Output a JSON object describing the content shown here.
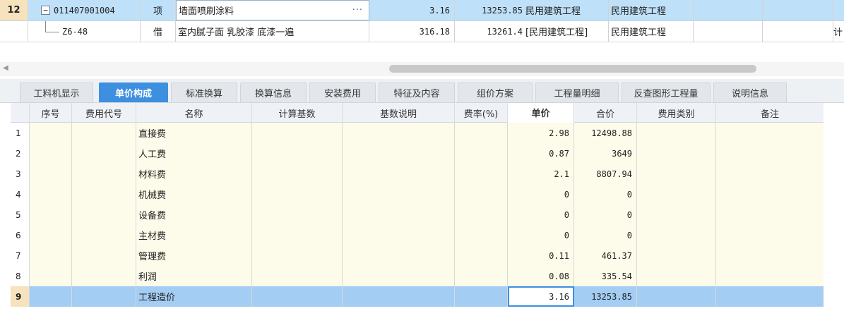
{
  "top_rows": [
    {
      "num": "12",
      "expander": "−",
      "code": "011407001004",
      "type": "项",
      "name": "墙面喷刷涂料",
      "more": "···",
      "quantity": "3.16",
      "total": "13253.85",
      "major": "民用建筑工程",
      "major2": "民用建筑工程"
    },
    {
      "num": "",
      "code": "Z6-48",
      "type": "借",
      "name": "室内腻子面 乳胶漆 底漆一遍",
      "quantity": "316.18",
      "total": "13261.4",
      "major": "[民用建筑工程]",
      "major2": "民用建筑工程",
      "edge": "计"
    }
  ],
  "scroll_left_arrow": "◀",
  "tabs": [
    {
      "label": "工料机显示",
      "active": false
    },
    {
      "label": "单价构成",
      "active": true
    },
    {
      "label": "标准换算",
      "active": false
    },
    {
      "label": "换算信息",
      "active": false
    },
    {
      "label": "安装费用",
      "active": false
    },
    {
      "label": "特征及内容",
      "active": false
    },
    {
      "label": "组价方案",
      "active": false
    },
    {
      "label": "工程量明细",
      "active": false
    },
    {
      "label": "反查图形工程量",
      "active": false
    },
    {
      "label": "说明信息",
      "active": false
    }
  ],
  "grid": {
    "headers": [
      "",
      "序号",
      "费用代号",
      "名称",
      "计算基数",
      "基数说明",
      "费率(%)",
      "单价",
      "合价",
      "费用类别",
      "备注"
    ],
    "selected_header": "单价",
    "rows": [
      {
        "idx": "1",
        "name": "直接费",
        "unit_price": "2.98",
        "total": "12498.88"
      },
      {
        "idx": "2",
        "name": "人工费",
        "unit_price": "0.87",
        "total": "3649"
      },
      {
        "idx": "3",
        "name": "材料费",
        "unit_price": "2.1",
        "total": "8807.94"
      },
      {
        "idx": "4",
        "name": "机械费",
        "unit_price": "0",
        "total": "0"
      },
      {
        "idx": "5",
        "name": "设备费",
        "unit_price": "0",
        "total": "0"
      },
      {
        "idx": "6",
        "name": "主材费",
        "unit_price": "0",
        "total": "0"
      },
      {
        "idx": "7",
        "name": "管理费",
        "unit_price": "0.11",
        "total": "461.37"
      },
      {
        "idx": "8",
        "name": "利润",
        "unit_price": "0.08",
        "total": "335.54"
      },
      {
        "idx": "9",
        "name": "工程造价",
        "unit_price": "3.16",
        "total": "13253.85"
      }
    ]
  },
  "colors": {
    "row_selected": "#bfe0f9",
    "tab_active": "#3d8fe0",
    "cell_yellow": "#fdfbe9",
    "total_row": "#a3cdf3"
  }
}
